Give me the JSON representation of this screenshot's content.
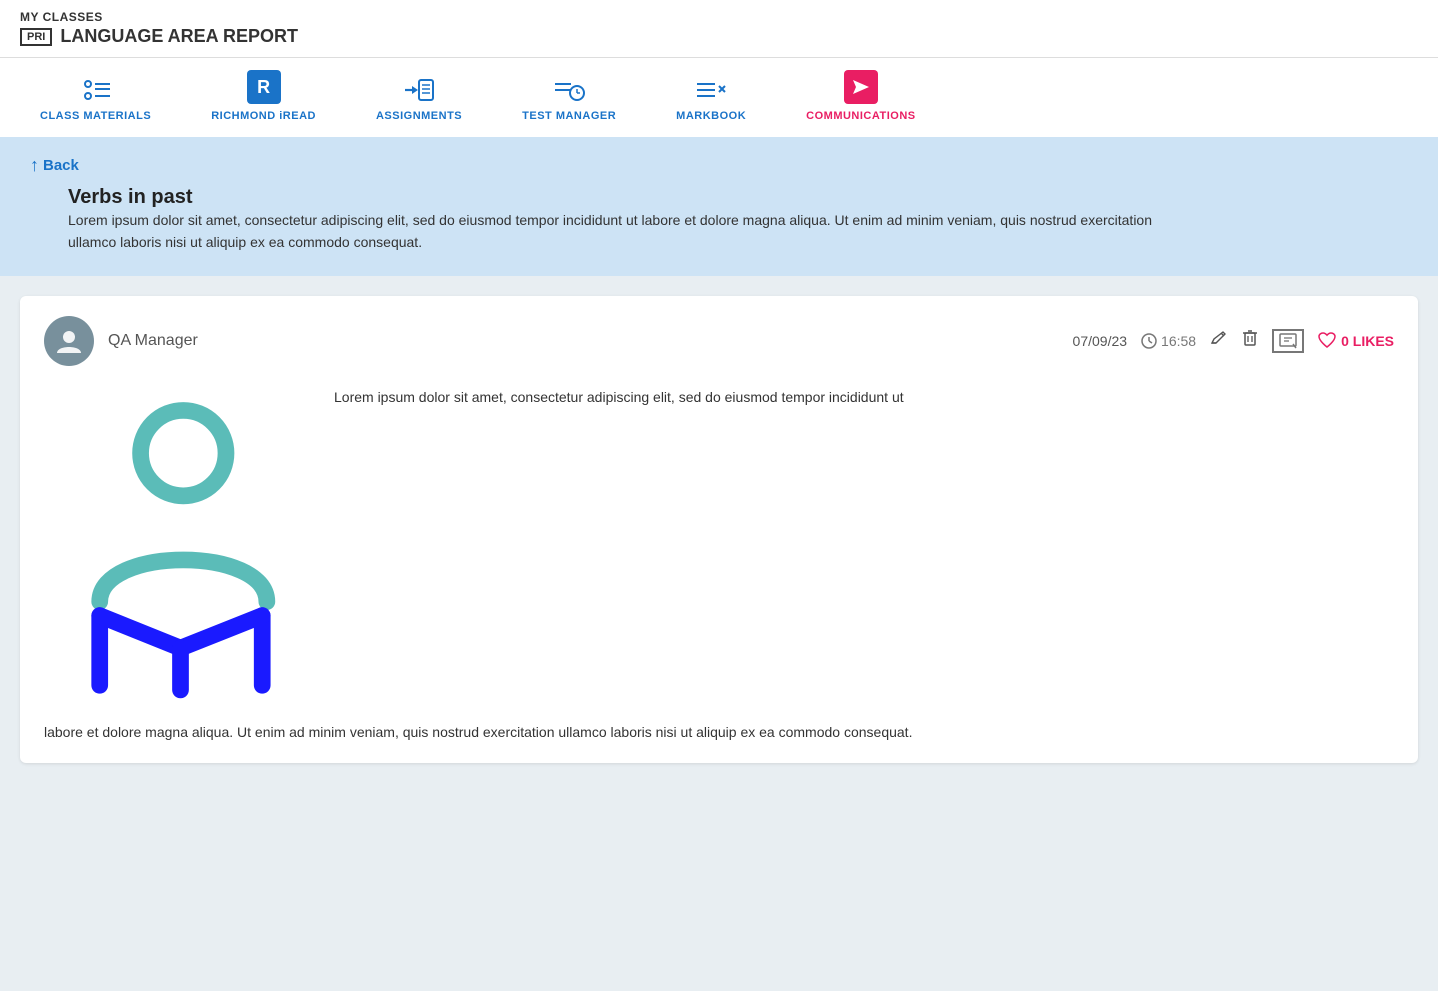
{
  "header": {
    "my_classes": "MY CLASSES",
    "pri_badge": "PRI",
    "report_title": "LANGUAGE AREA REPORT"
  },
  "nav": {
    "items": [
      {
        "id": "class-materials",
        "label": "CLASS MATERIALS",
        "type": "blue"
      },
      {
        "id": "richmond-iread",
        "label": "RICHMOND iREAD",
        "type": "blue-box"
      },
      {
        "id": "assignments",
        "label": "ASSIGNMENTS",
        "type": "blue"
      },
      {
        "id": "test-manager",
        "label": "TEST MANAGER",
        "type": "blue"
      },
      {
        "id": "markbook",
        "label": "MARKBOOK",
        "type": "blue"
      },
      {
        "id": "communications",
        "label": "COMMUNICATIONS",
        "type": "red"
      }
    ]
  },
  "info_bar": {
    "back_label": "Back",
    "post_title": "Verbs in past",
    "post_description": "Lorem ipsum dolor sit amet, consectetur adipiscing elit, sed do eiusmod tempor incididunt ut labore et dolore magna aliqua. Ut enim ad minim veniam, quis nostrud exercitation ullamco laboris nisi ut aliquip ex ea commodo consequat."
  },
  "post": {
    "author": "QA Manager",
    "date": "07/09/23",
    "time": "16:58",
    "likes_count": "0 LIKES",
    "body_text_top": "Lorem ipsum dolor sit amet, consectetur adipiscing elit, sed do eiusmod tempor incididunt ut",
    "body_text_bottom": "labore et dolore magna aliqua. Ut enim ad minim veniam, quis nostrud exercitation ullamco laboris nisi ut aliquip ex ea commodo consequat."
  }
}
